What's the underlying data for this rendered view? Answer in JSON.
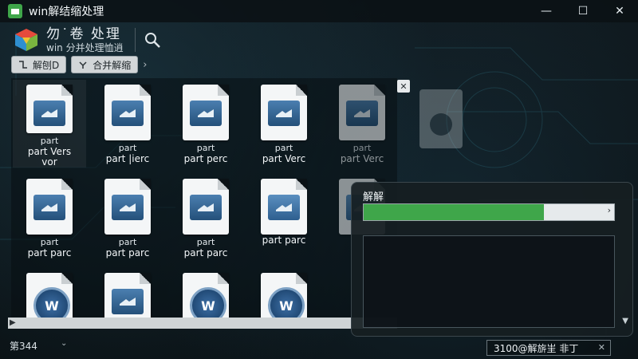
{
  "window": {
    "title": "win解结缩处理",
    "controls": [
      "—",
      "☐",
      "✕"
    ]
  },
  "header": {
    "app_name": "勿˙卷 处理",
    "subtitle": "win 分并处理恤逍"
  },
  "toolbar": {
    "btn1": "解刨D",
    "btn2": "合并解缩",
    "sep": "›"
  },
  "files": [
    {
      "l1": "part",
      "l2": "part Vers",
      "l3": "vor",
      "icon": "doc-monitor",
      "selected": true
    },
    {
      "l1": "part",
      "l2": "part |ierc",
      "l3": "",
      "icon": "doc-monitor",
      "selected": false
    },
    {
      "l1": "part",
      "l2": "part perc",
      "l3": "",
      "icon": "doc-monitor",
      "selected": false
    },
    {
      "l1": "part",
      "l2": "part Verc",
      "l3": "",
      "icon": "doc-monitor",
      "selected": false
    },
    {
      "l1": "part",
      "l2": "part Verc",
      "l3": "",
      "icon": "doc-monitor",
      "selected": false
    },
    {
      "l1": "part",
      "l2": "part parc",
      "l3": "",
      "icon": "doc-monitor",
      "selected": false
    },
    {
      "l1": "part",
      "l2": "part parc",
      "l3": "",
      "icon": "doc-monitor",
      "selected": false
    },
    {
      "l1": "part",
      "l2": "part parc",
      "l3": "",
      "icon": "doc-monitor",
      "selected": false
    },
    {
      "l1": "",
      "l2": "part parc",
      "l3": "",
      "icon": "doc-gear",
      "selected": false
    },
    {
      "l1": "",
      "l2": "",
      "l3": "",
      "icon": "doc-gear",
      "selected": false
    },
    {
      "l1": "",
      "l2": "",
      "l3": "",
      "icon": "doc-w",
      "selected": false
    },
    {
      "l1": "",
      "l2": "",
      "l3": "",
      "icon": "doc-monitor",
      "selected": false
    },
    {
      "l1": "",
      "l2": "",
      "l3": "",
      "icon": "doc-w",
      "selected": false
    },
    {
      "l1": "",
      "l2": "",
      "l3": "",
      "icon": "doc-w",
      "selected": false
    }
  ],
  "progress": {
    "title": "解解",
    "fraction": 0.72,
    "arrow": "›"
  },
  "status": {
    "left": "第344",
    "right": "3100@解旂㞷 ⾮丁",
    "close": "✕"
  },
  "colors": {
    "progress_fill": "#3fa64a",
    "accent_blue": "#2e5f8f"
  }
}
